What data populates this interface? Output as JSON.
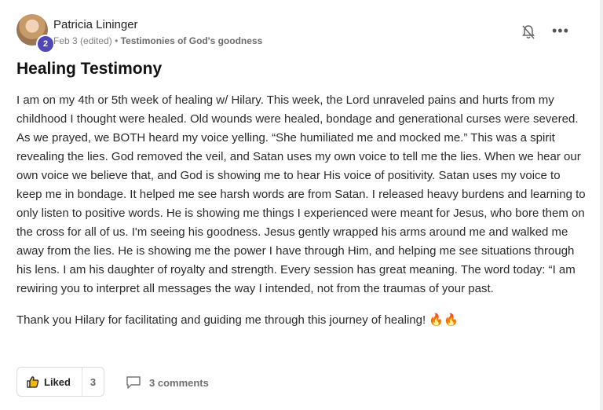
{
  "post": {
    "author": "Patricia Lininger",
    "level": "2",
    "date": "Feb 3 (edited)",
    "separator": "•",
    "category": "Testimonies of God's goodness",
    "title": "Healing Testimony",
    "body_1": "I am on my 4th or 5th week of healing w/ Hilary. This week, the Lord unraveled pains and hurts from my childhood I thought were healed. Old wounds were healed, bondage and generational curses were severed. As we prayed, we BOTH heard my voice yelling. “She humiliated me and mocked me.” This was a spirit revealing the lies. God removed the veil, and Satan uses my own voice to tell me the lies. When we hear our own voice we believe that, and God is showing me to hear His voice of positivity. Satan uses my voice to keep me in bondage. It helped me see harsh words are from Satan. I released heavy burdens and learning to only listen to positive words. He is showing me things I experienced were meant for Jesus, who bore them on the cross for all of us. I'm seeing his goodness. Jesus gently wrapped his arms around me and walked me away from the lies. He is showing me the power I have through Him, and helping me see situations through his lens. I am his daughter of royalty and strength. Every session has great meaning. The word today: “I am rewiring you to interpret all messages the way I intended, not from the traumas of your past.",
    "body_2": "Thank you Hilary for facilitating and guiding me through this journey of healing! 🔥🔥"
  },
  "actions": {
    "like_label": "Liked",
    "like_count": "3",
    "comments_label": "3 comments"
  },
  "icons": {
    "bell": "bell-muted-icon",
    "more": "more-horizontal-icon",
    "like": "thumbs-up-icon",
    "comment": "comment-icon"
  },
  "colors": {
    "level_badge": "#4f46b8",
    "meta_text": "#808080"
  }
}
